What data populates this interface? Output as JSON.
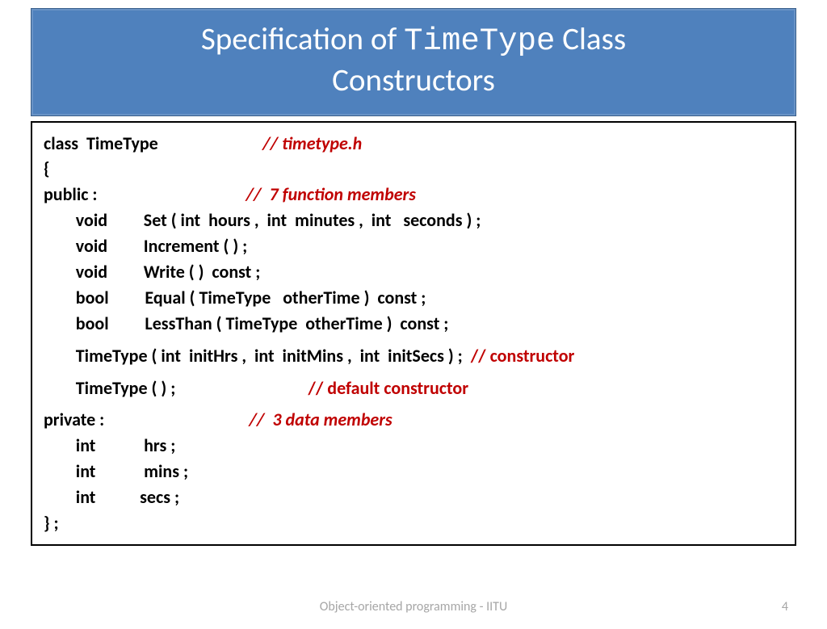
{
  "title": {
    "part1": "Specification of ",
    "mono": "TimeType",
    "part2": "  Class",
    "line2": "Constructors"
  },
  "code": {
    "l1a": "class  TimeType                          ",
    "l1c": "// timetype.h",
    "l2": "{",
    "l3a": "public :                                     ",
    "l3c": "//  7 function members",
    "l4": "        void         Set ( int  hours ,  int  minutes ,  int   seconds ) ;",
    "l5": "        void         Increment ( ) ;",
    "l6": "        void         Write ( )  const ;",
    "l7": "        bool         Equal ( TimeType   otherTime )  const ;",
    "l8": "        bool         LessThan ( TimeType  otherTime )  const ;",
    "l9a": "        TimeType ( int  initHrs ,  int  initMins ,  int  initSecs ) ;  ",
    "l9c": "// constructor",
    "l10a": "        TimeType ( ) ;                                 ",
    "l10c": "// default constructor",
    "l11a": "private :                                    ",
    "l11c": "//  3 data members",
    "l12": "        int            hrs ;",
    "l13": "        int            mins ;",
    "l14": "        int           secs ;",
    "l15": "} ;"
  },
  "footer": "Object-oriented programming - IITU",
  "page": "4"
}
